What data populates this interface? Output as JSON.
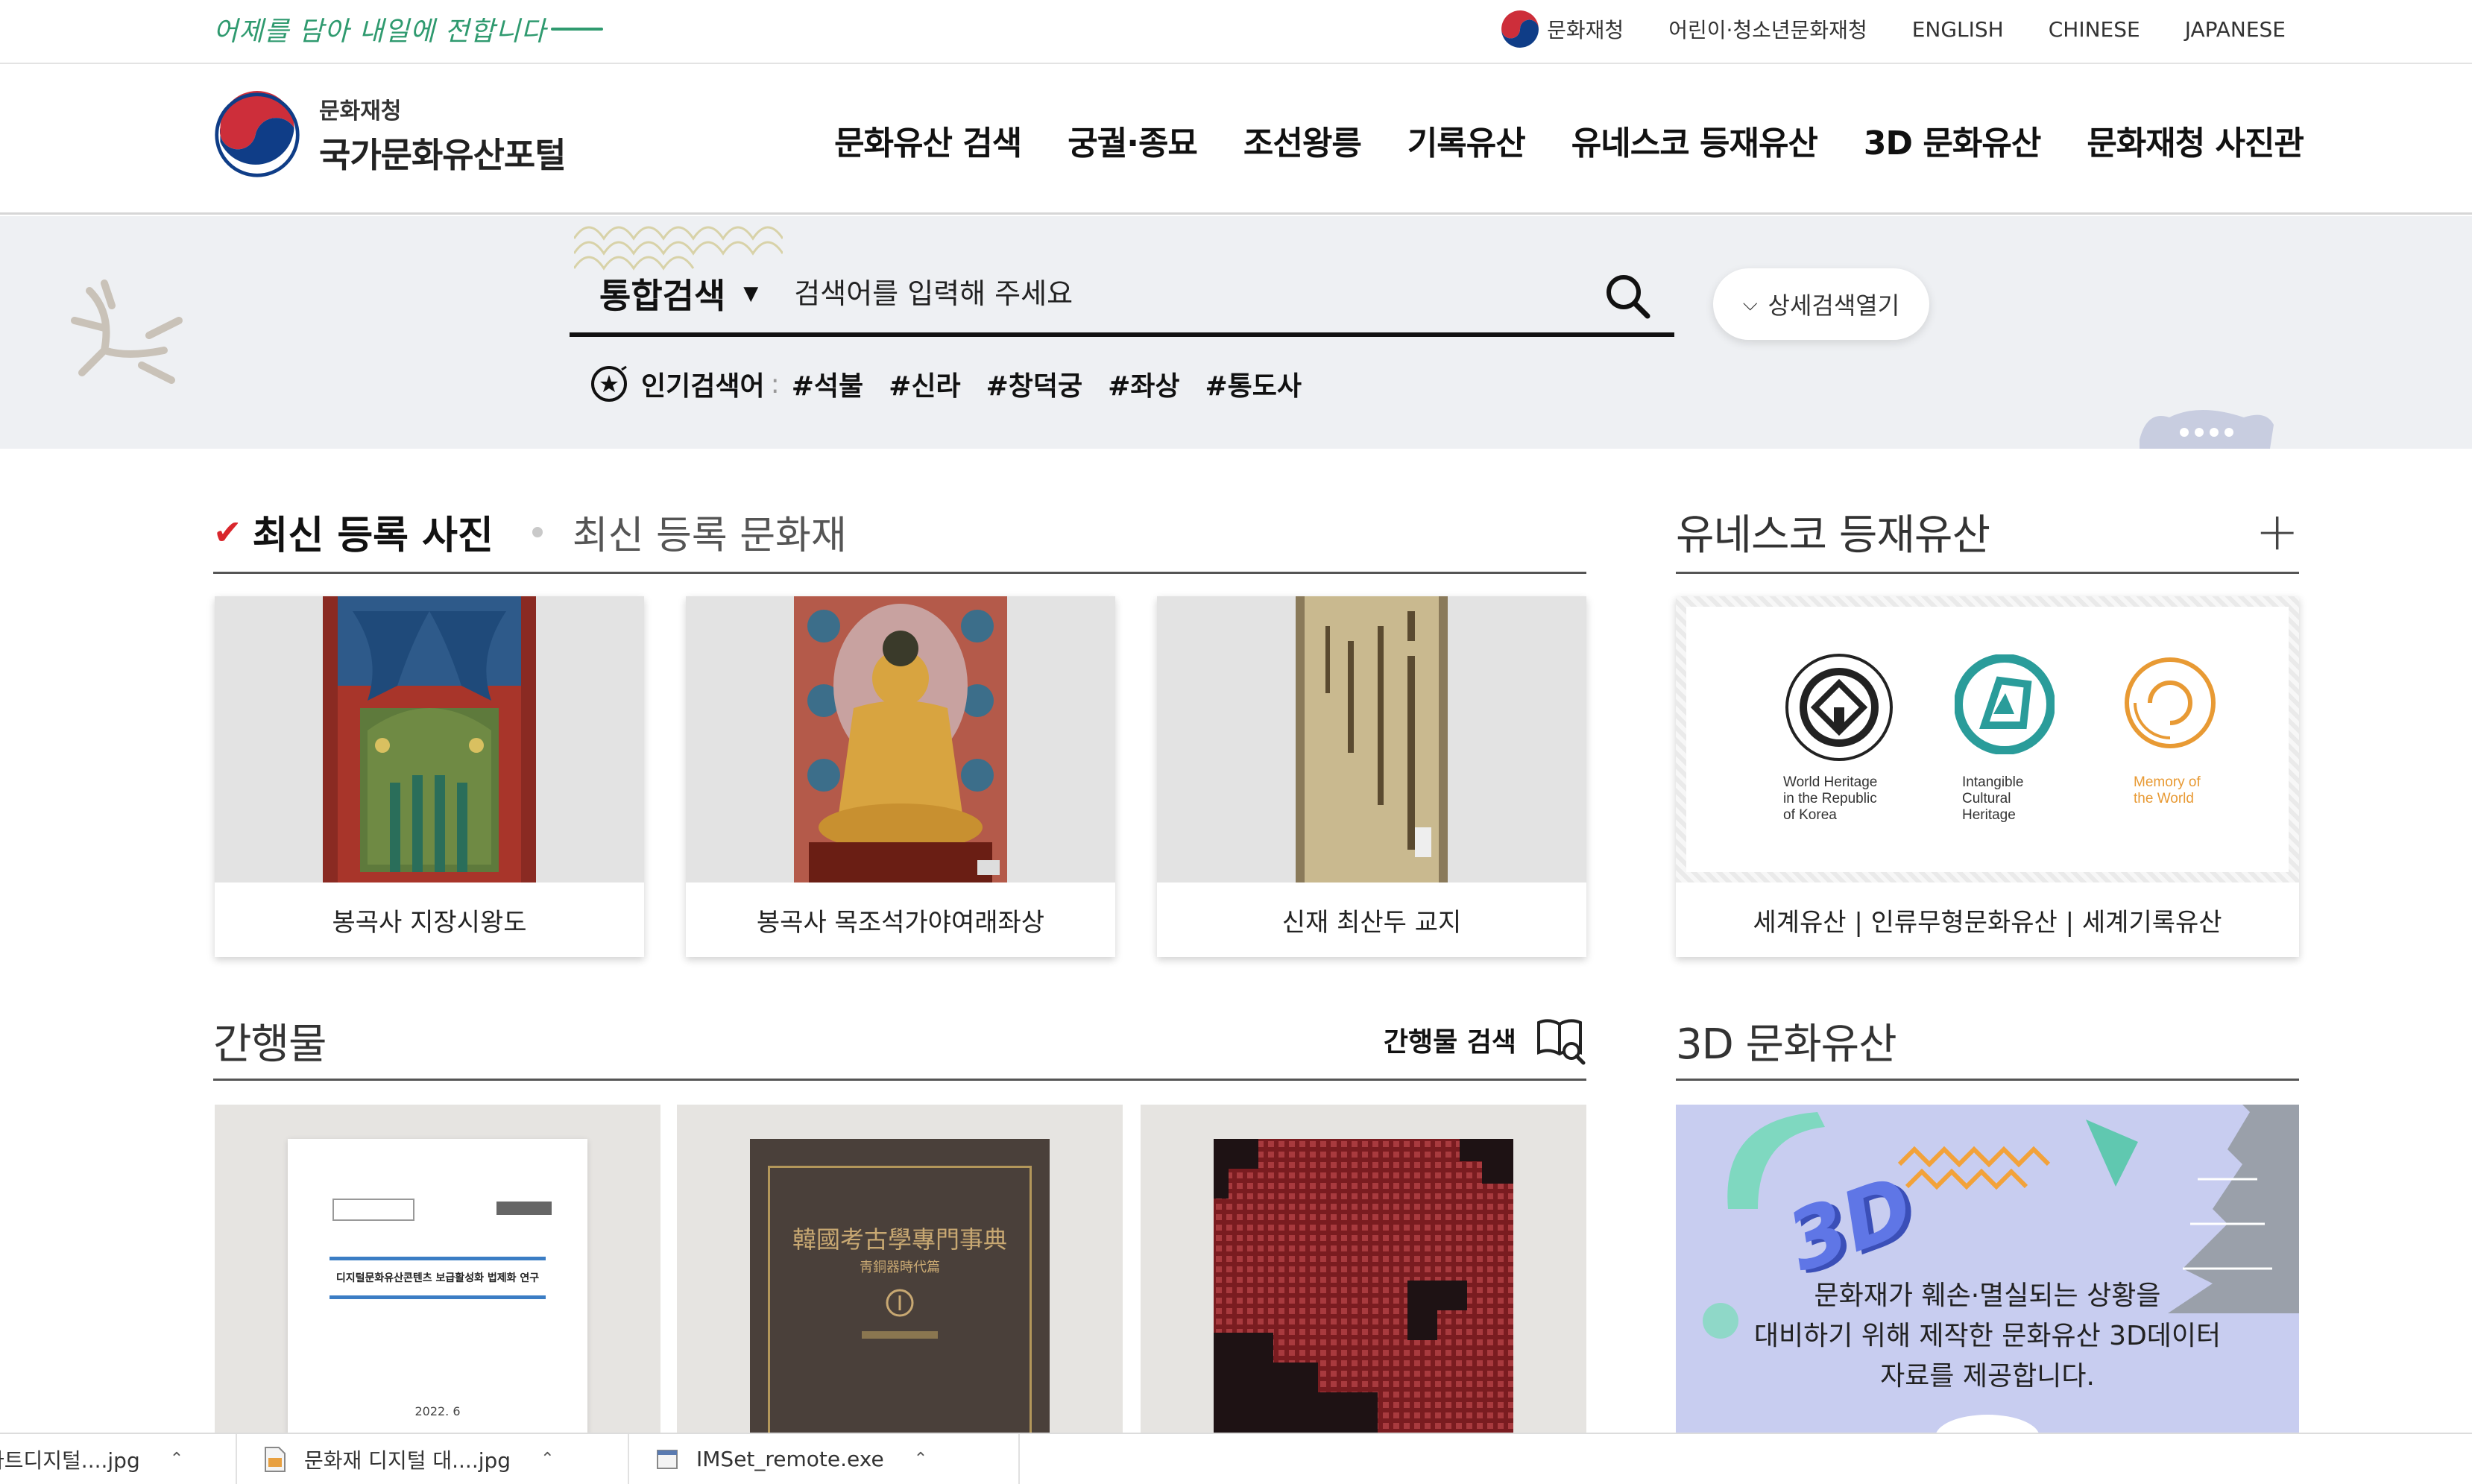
{
  "utility": {
    "slogan": "어제를 담아 내일에 전합니다",
    "links": [
      "문화재청",
      "어린이·청소년문화재청",
      "ENGLISH",
      "CHINESE",
      "JAPANESE"
    ]
  },
  "header": {
    "logo_org": "문화재청",
    "logo_name": "국가문화유산포털",
    "nav": [
      "문화유산 검색",
      "궁궐·종묘",
      "조선왕릉",
      "기록유산",
      "유네스코 등재유산",
      "3D 문화유산",
      "문화재청 사진관"
    ]
  },
  "search": {
    "scope": "통합검색",
    "placeholder": "검색어를 입력해 주세요",
    "advanced_label": "상세검색열기",
    "popular_label": "인기검색어",
    "popular_colon": ":",
    "popular_tags": [
      "#석불",
      "#신라",
      "#창덕궁",
      "#좌상",
      "#통도사"
    ]
  },
  "latest": {
    "tab_active": "최신 등록 사진",
    "tab_inactive": "최신 등록 문화재",
    "items": [
      "봉곡사 지장시왕도",
      "봉곡사 목조석가야여래좌상",
      "신재 최산두 교지"
    ]
  },
  "unesco": {
    "title": "유네스코 등재유산",
    "plus": "+",
    "logo_labels": [
      [
        "World Heritage",
        "in the Republic",
        "of Korea"
      ],
      [
        "Intangible",
        "Cultural",
        "Heritage"
      ],
      [
        "Memory of",
        "the World"
      ]
    ],
    "caption": "세계유산 | 인류무형문화유산 | 세계기록유산"
  },
  "publications": {
    "title": "간행물",
    "search_label": "간행물 검색",
    "book1": {
      "small_title": "디지털문화유산콘텐츠 보급활성화 법제화 연구",
      "date": "2022. 6"
    },
    "book2": {
      "title": "韓國考古學專門事典",
      "subtitle": "靑銅器時代篇"
    }
  },
  "heritage3d": {
    "title": "3D 문화유산",
    "badge": "3D",
    "lines": [
      "문화재가 훼손·멸실되는 상황을",
      "대비하기 위해 제작한 문화유산 3D데이터",
      "자료를 제공합니다."
    ]
  },
  "downloads": [
    "아트디지털....jpg",
    "문화재 디지털 대....jpg",
    "IMSet_remote.exe"
  ],
  "colors": {
    "accent_red": "#d9262c",
    "slogan_green": "#2f9a6f",
    "band_bg": "#eef0f3",
    "banner_bg": "#c8cdf0"
  }
}
